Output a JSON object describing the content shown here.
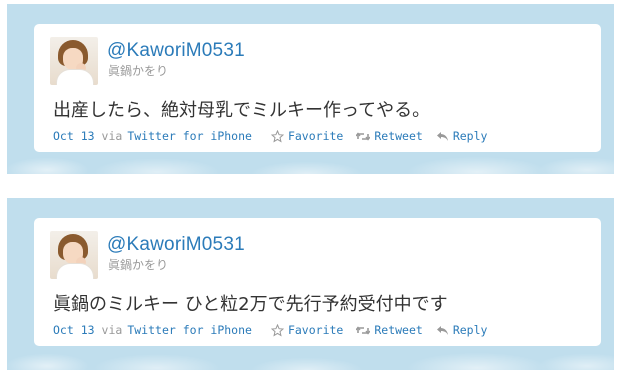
{
  "tweets": [
    {
      "handle": "@KaworiM0531",
      "name": "眞鍋かをり",
      "text": "出産したら、絶対母乳でミルキー作ってやる。",
      "date": "Oct 13",
      "via": "via",
      "client": "Twitter for iPhone",
      "favorite": "Favorite",
      "retweet": "Retweet",
      "reply": "Reply"
    },
    {
      "handle": "@KaworiM0531",
      "name": "眞鍋かをり",
      "text": "眞鍋のミルキー ひと粒2万で先行予約受付中です",
      "date": "Oct 13",
      "via": "via",
      "client": "Twitter for iPhone",
      "favorite": "Favorite",
      "retweet": "Retweet",
      "reply": "Reply"
    }
  ],
  "colors": {
    "frame": "#c0deed",
    "link": "#2b7bb9",
    "meta": "#999999",
    "text": "#333333"
  }
}
